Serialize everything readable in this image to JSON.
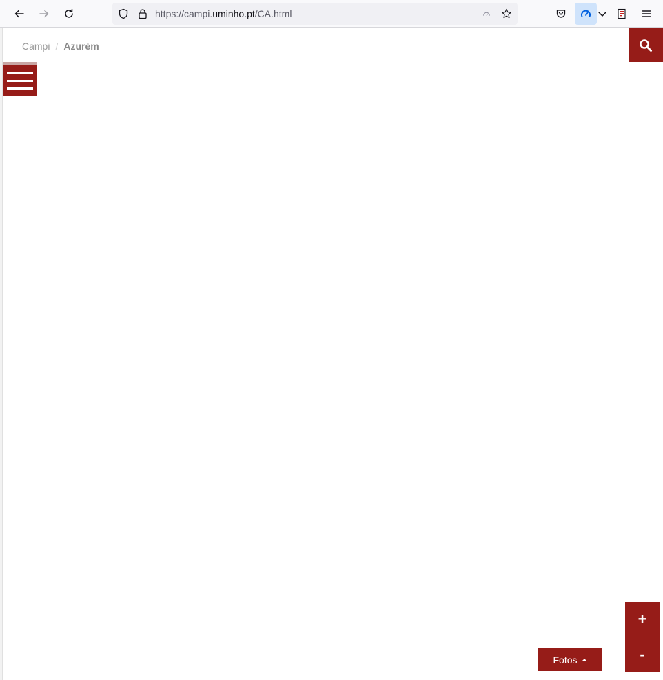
{
  "browser": {
    "url_prefix": "https://campi.",
    "url_domain": "uminho.pt",
    "url_suffix": "/CA.html"
  },
  "breadcrumb": {
    "items": [
      "Campi"
    ],
    "separator": "/",
    "current": "Azurém"
  },
  "map_controls": {
    "zoom_in_label": "+",
    "zoom_out_label": "-",
    "fotos_label": "Fotos"
  },
  "colors": {
    "brand": "#961c18",
    "toolbar_bg": "#f9f9fb",
    "urlbar_bg": "#f0f0f4"
  }
}
